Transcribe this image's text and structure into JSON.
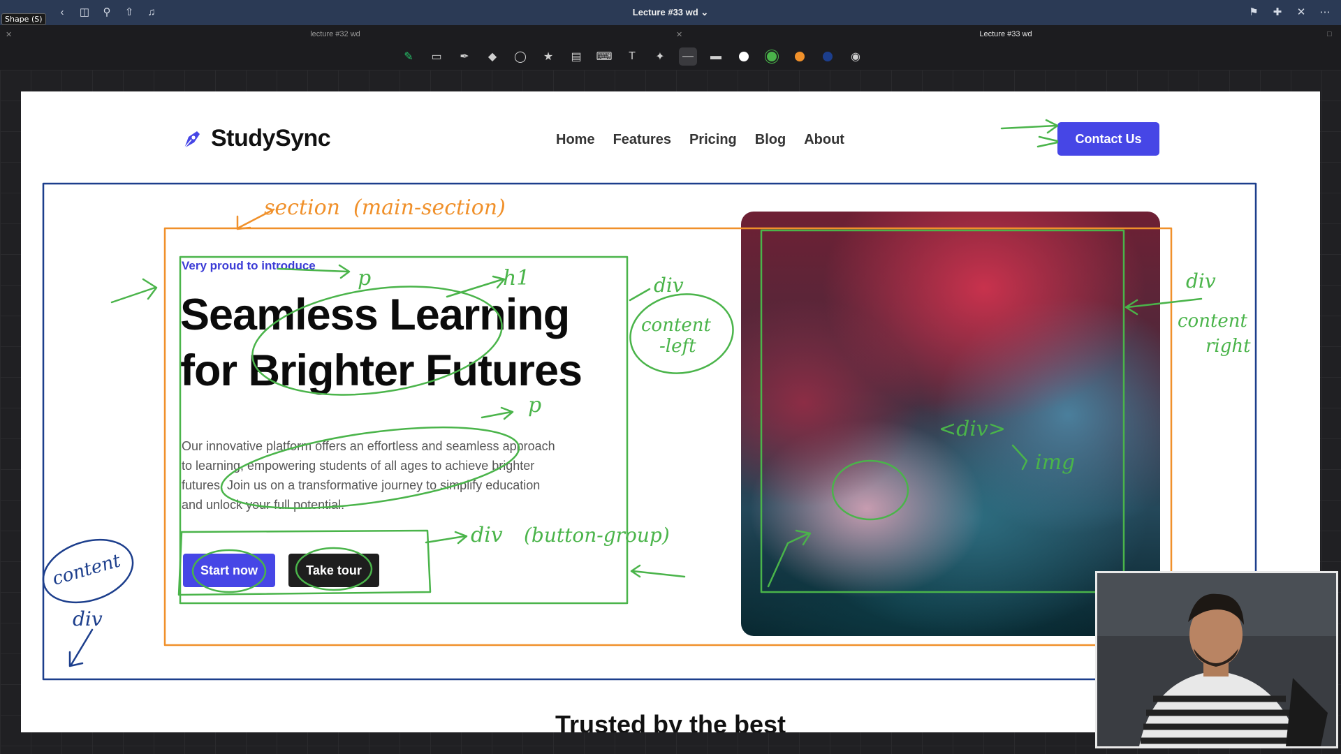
{
  "app": {
    "tool_hint": "Shape (S)",
    "document_title": "Lecture #33 wd",
    "tabs": [
      {
        "label": "lecture #32 wd",
        "active": false
      },
      {
        "label": "Lecture #33 wd",
        "active": true
      }
    ],
    "toolbar_tools": [
      "pen-icon",
      "eraser-icon",
      "highlighter-icon",
      "shapes-icon",
      "lasso-icon",
      "sticker-icon",
      "image-icon",
      "keyboard-icon",
      "text-box-icon",
      "laser-pointer-icon"
    ],
    "pen_colors": [
      "#ffffff",
      "#4ab44a",
      "#f0902a",
      "#1c3e8c"
    ],
    "active_pen_color": "#4ab44a"
  },
  "site": {
    "brand": "StudySync",
    "nav": [
      "Home",
      "Features",
      "Pricing",
      "Blog",
      "About"
    ],
    "contact_label": "Contact Us",
    "eyebrow": "Very proud to introduce",
    "headline_line1": "Seamless Learning",
    "headline_line2": "for Brighter Futures",
    "paragraph": "Our innovative platform offers an effortless and seamless approach to learning, empowering students of all ages to achieve brighter futures. Join us on a transformative journey to simplify education and unlock your full potential.",
    "btn_primary": "Start now",
    "btn_secondary": "Take tour",
    "next_section_title": "Trusted by the best",
    "accent_color": "#4646e6"
  },
  "annotations": {
    "section": "section",
    "main_section": "(main-section)",
    "p_top": "p",
    "h1": "h1",
    "div_left": "div",
    "content_left": "content",
    "content_left2": "-left",
    "p_mid": "p",
    "div_buttons": "div",
    "button_group": "(button-group)",
    "content_div": "content",
    "content_div2": "div",
    "div_right": "div",
    "content_right": "content",
    "content_right2": "right",
    "div_img": "<div>",
    "img": "img"
  }
}
